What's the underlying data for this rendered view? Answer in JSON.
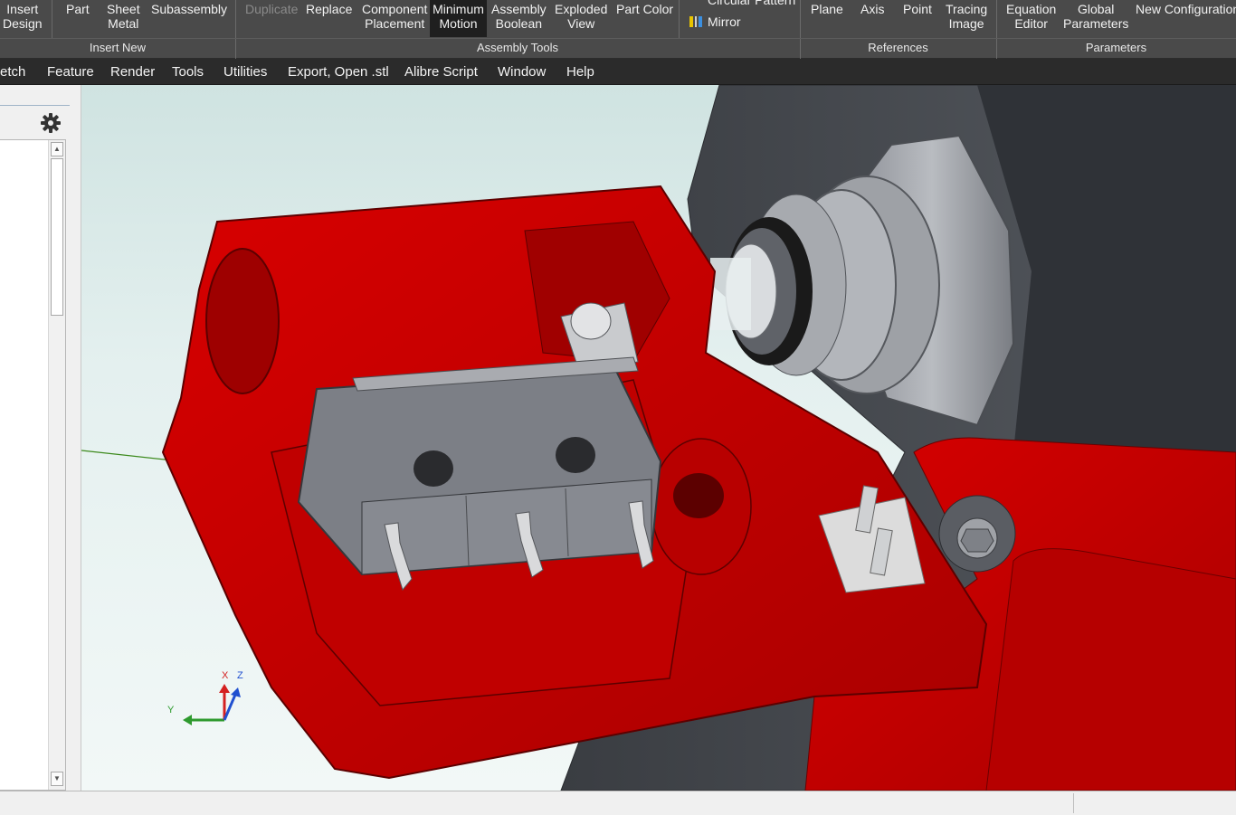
{
  "ribbon": {
    "insert_design": [
      "Insert",
      "Design"
    ],
    "part": "Part",
    "sheet_metal": [
      "Sheet",
      "Metal"
    ],
    "subassembly": "Subassembly",
    "duplicate": "Duplicate",
    "replace": "Replace",
    "component_placement": [
      "Component",
      "Placement"
    ],
    "minimum_motion": [
      "Minimum",
      "Motion"
    ],
    "assembly_boolean": [
      "Assembly",
      "Boolean"
    ],
    "exploded_view": [
      "Exploded",
      "View"
    ],
    "part_color": "Part Color",
    "circular_pattern_partial": "Circular Pattern",
    "mirror": "Mirror",
    "plane": "Plane",
    "axis": "Axis",
    "point": "Point",
    "tracing_image": [
      "Tracing",
      "Image"
    ],
    "equation_editor": [
      "Equation",
      "Editor"
    ],
    "global_parameters": [
      "Global",
      "Parameters"
    ],
    "new_configuration": "New Configuration",
    "groups": [
      "Insert New",
      "Assembly Tools",
      "References",
      "Parameters"
    ]
  },
  "menu": [
    "etch",
    "Feature",
    "Render",
    "Tools",
    "Utilities",
    "Export, Open .stl",
    "Alibre Script",
    "Window",
    "Help"
  ],
  "triad": {
    "x": "X",
    "y": "Y",
    "z": "Z"
  },
  "colors": {
    "ribbon": "#4a4a4a",
    "menubar": "#2b2b2b",
    "part_red": "#c40000",
    "switch_grey": "#7c7f86"
  }
}
